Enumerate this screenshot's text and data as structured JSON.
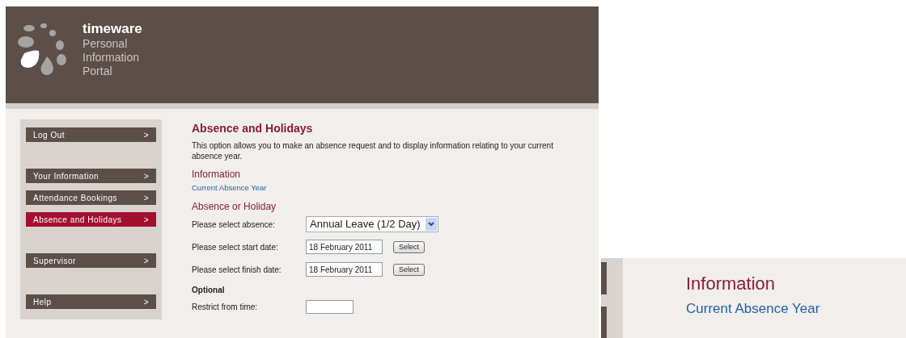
{
  "header": {
    "brand": "timeware",
    "subtitle": [
      "Personal",
      "Information",
      "Portal"
    ]
  },
  "nav_groups": [
    [
      {
        "label": "Log Out",
        "arrow": ">",
        "selected": false
      }
    ],
    [
      {
        "label": "Your Information",
        "arrow": ">",
        "selected": false
      },
      {
        "label": "Attendance Bookings",
        "arrow": ">",
        "selected": false
      },
      {
        "label": "Absence and Holidays",
        "arrow": ">",
        "selected": true
      }
    ],
    [
      {
        "label": "Supervisor",
        "arrow": ">",
        "selected": false
      }
    ],
    [
      {
        "label": "Help",
        "arrow": ">",
        "selected": false
      }
    ]
  ],
  "content": {
    "title": "Absence and Holidays",
    "description": "This option allows you to make an absence request and to display information relating to your current absence year.",
    "information": {
      "heading": "Information",
      "link": "Current Absence Year"
    },
    "absence": {
      "heading": "Absence or Holiday",
      "rows": [
        {
          "kind": "select",
          "label": "Please select absence:",
          "value": "Annual Leave (1/2 Day)"
        },
        {
          "kind": "date",
          "label": "Please select start date:",
          "value": "18 February 2011",
          "button": "Select"
        },
        {
          "kind": "date",
          "label": "Please select finish date:",
          "value": "18 February 2011",
          "button": "Select"
        }
      ]
    },
    "optional": {
      "heading": "Optional",
      "rows": [
        {
          "kind": "time",
          "label": "Restrict from time:"
        }
      ]
    }
  },
  "inset": {
    "heading": "Information",
    "link": "Current Absence Year"
  }
}
